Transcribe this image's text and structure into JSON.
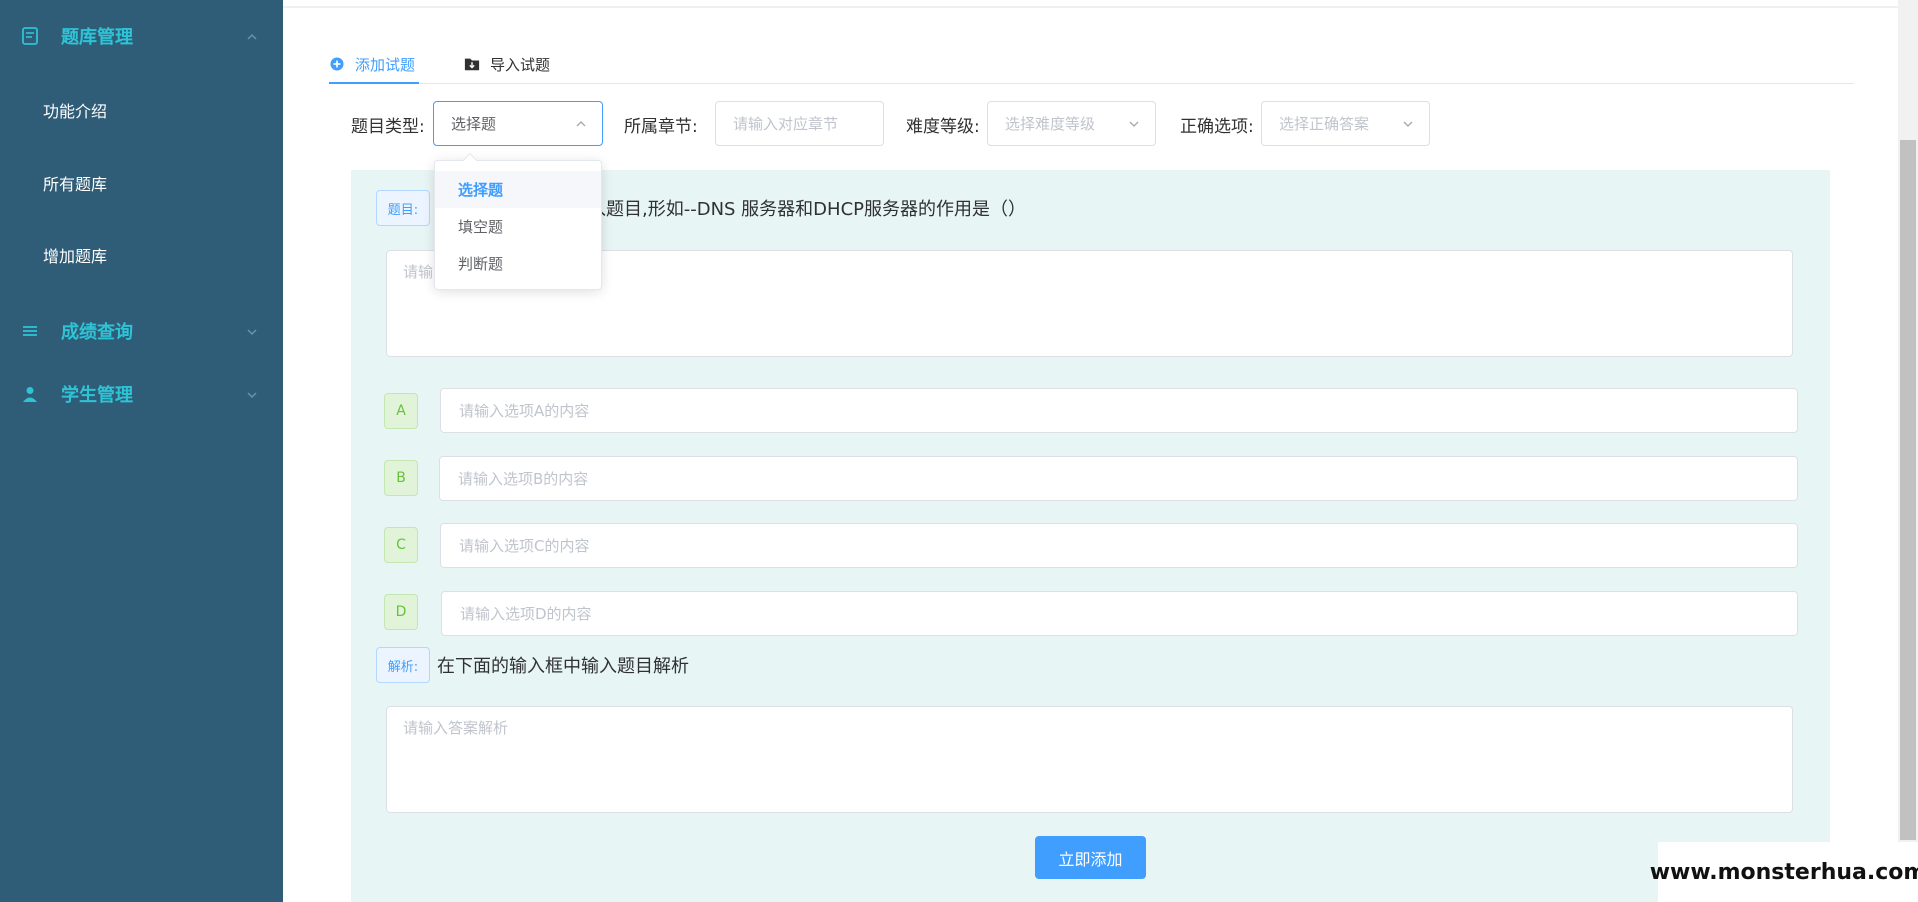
{
  "sidebar": {
    "groups": [
      {
        "label": "题库管理",
        "icon": "document-icon",
        "expanded": true
      },
      {
        "label": "成绩查询",
        "icon": "list-icon",
        "expanded": false
      },
      {
        "label": "学生管理",
        "icon": "user-icon",
        "expanded": false
      }
    ],
    "items": [
      "功能介绍",
      "所有题库",
      "增加题库"
    ]
  },
  "tabs": [
    {
      "label": "添加试题",
      "icon": "plus-circle-icon",
      "active": true
    },
    {
      "label": "导入试题",
      "icon": "folder-download-icon",
      "active": false
    }
  ],
  "filters": {
    "type_label": "题目类型:",
    "type_value": "选择题",
    "chapter_label": "所属章节:",
    "chapter_placeholder": "请输入对应章节",
    "difficulty_label": "难度等级:",
    "difficulty_placeholder": "选择难度等级",
    "answer_label": "正确选项:",
    "answer_placeholder": "选择正确答案"
  },
  "dropdown": {
    "options": [
      "选择题",
      "填空题",
      "判断题"
    ],
    "selected": "选择题"
  },
  "form": {
    "question_tag": "题目:",
    "question_hint": "入题目,形如--DNS 服务器和DHCP服务器的作用是（）",
    "question_placeholder": "请输",
    "options": [
      {
        "letter": "A",
        "placeholder": "请输入选项A的内容"
      },
      {
        "letter": "B",
        "placeholder": "请输入选项B的内容"
      },
      {
        "letter": "C",
        "placeholder": "请输入选项C的内容"
      },
      {
        "letter": "D",
        "placeholder": "请输入选项D的内容"
      }
    ],
    "analysis_tag": "解析:",
    "analysis_hint": "在下面的输入框中输入题目解析",
    "analysis_placeholder": "请输入答案解析",
    "submit_label": "立即添加"
  },
  "watermark": "www.monsterhua.com",
  "colors": {
    "sidebar_bg": "#2f5c76",
    "sidebar_accent": "#2fc3d6",
    "primary": "#409eff",
    "panel_bg": "#e8f5f5",
    "option_tag": "#67c23a"
  }
}
